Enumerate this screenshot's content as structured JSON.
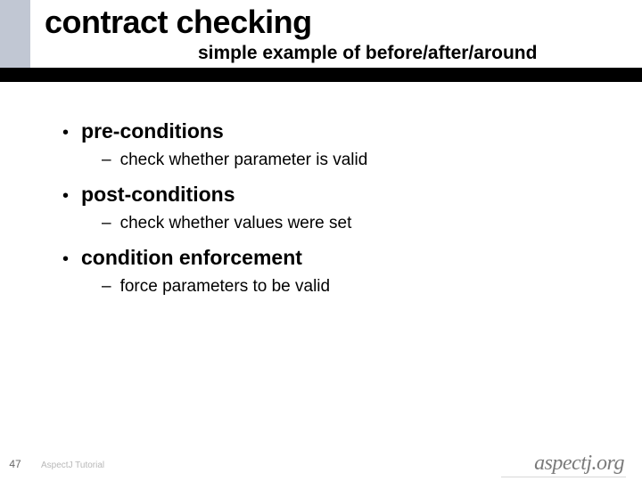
{
  "header": {
    "title": "contract checking",
    "subtitle": "simple example of before/after/around"
  },
  "bullets": [
    {
      "main": "pre-conditions",
      "sub": "check whether parameter is valid"
    },
    {
      "main": "post-conditions",
      "sub": "check whether values were set"
    },
    {
      "main": "condition enforcement",
      "sub": "force parameters to be valid"
    }
  ],
  "footer": {
    "slide_number": "47",
    "label": "AspectJ Tutorial",
    "logo_text": "aspectj",
    "logo_suffix": ".org"
  }
}
